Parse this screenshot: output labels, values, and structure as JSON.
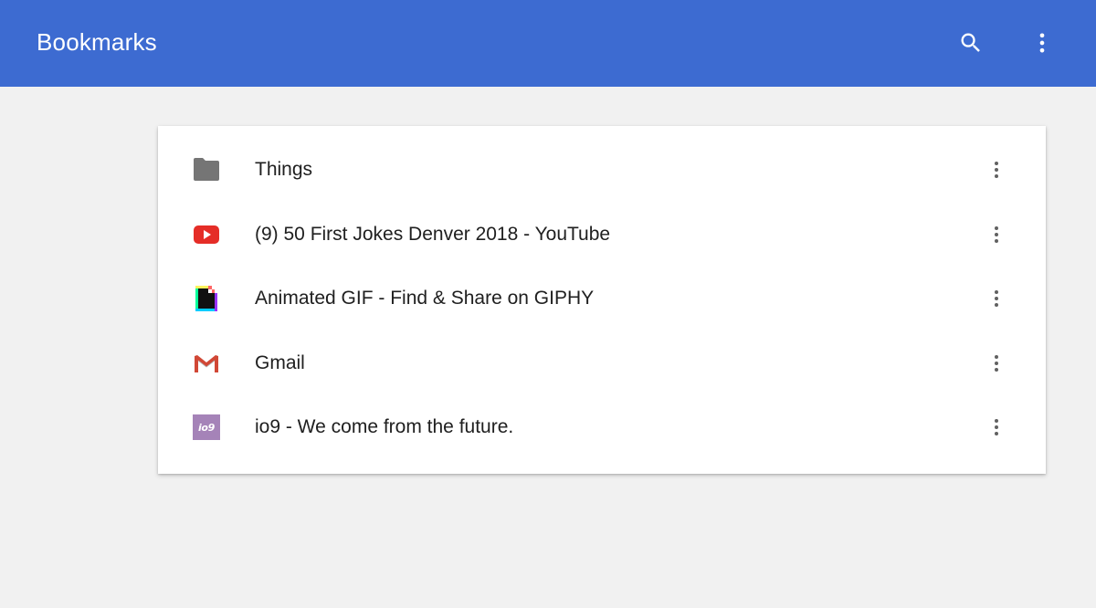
{
  "header": {
    "title": "Bookmarks",
    "search_icon": "search-icon",
    "menu_icon": "more-vert-icon"
  },
  "colors": {
    "appbar": "#3d6bd1",
    "background": "#f1f1f1",
    "folder": "#757575",
    "youtube": "#e52d27",
    "gmail": "#d14836",
    "io9": "#a583b8"
  },
  "bookmarks": [
    {
      "label": "Things",
      "icon": "folder-icon"
    },
    {
      "label": "(9) 50 First Jokes Denver 2018 - YouTube",
      "icon": "youtube-favicon"
    },
    {
      "label": "Animated GIF - Find & Share on GIPHY",
      "icon": "giphy-favicon"
    },
    {
      "label": "Gmail",
      "icon": "gmail-favicon"
    },
    {
      "label": "io9 - We come from the future.",
      "icon": "io9-favicon",
      "icon_text": "io9"
    }
  ]
}
